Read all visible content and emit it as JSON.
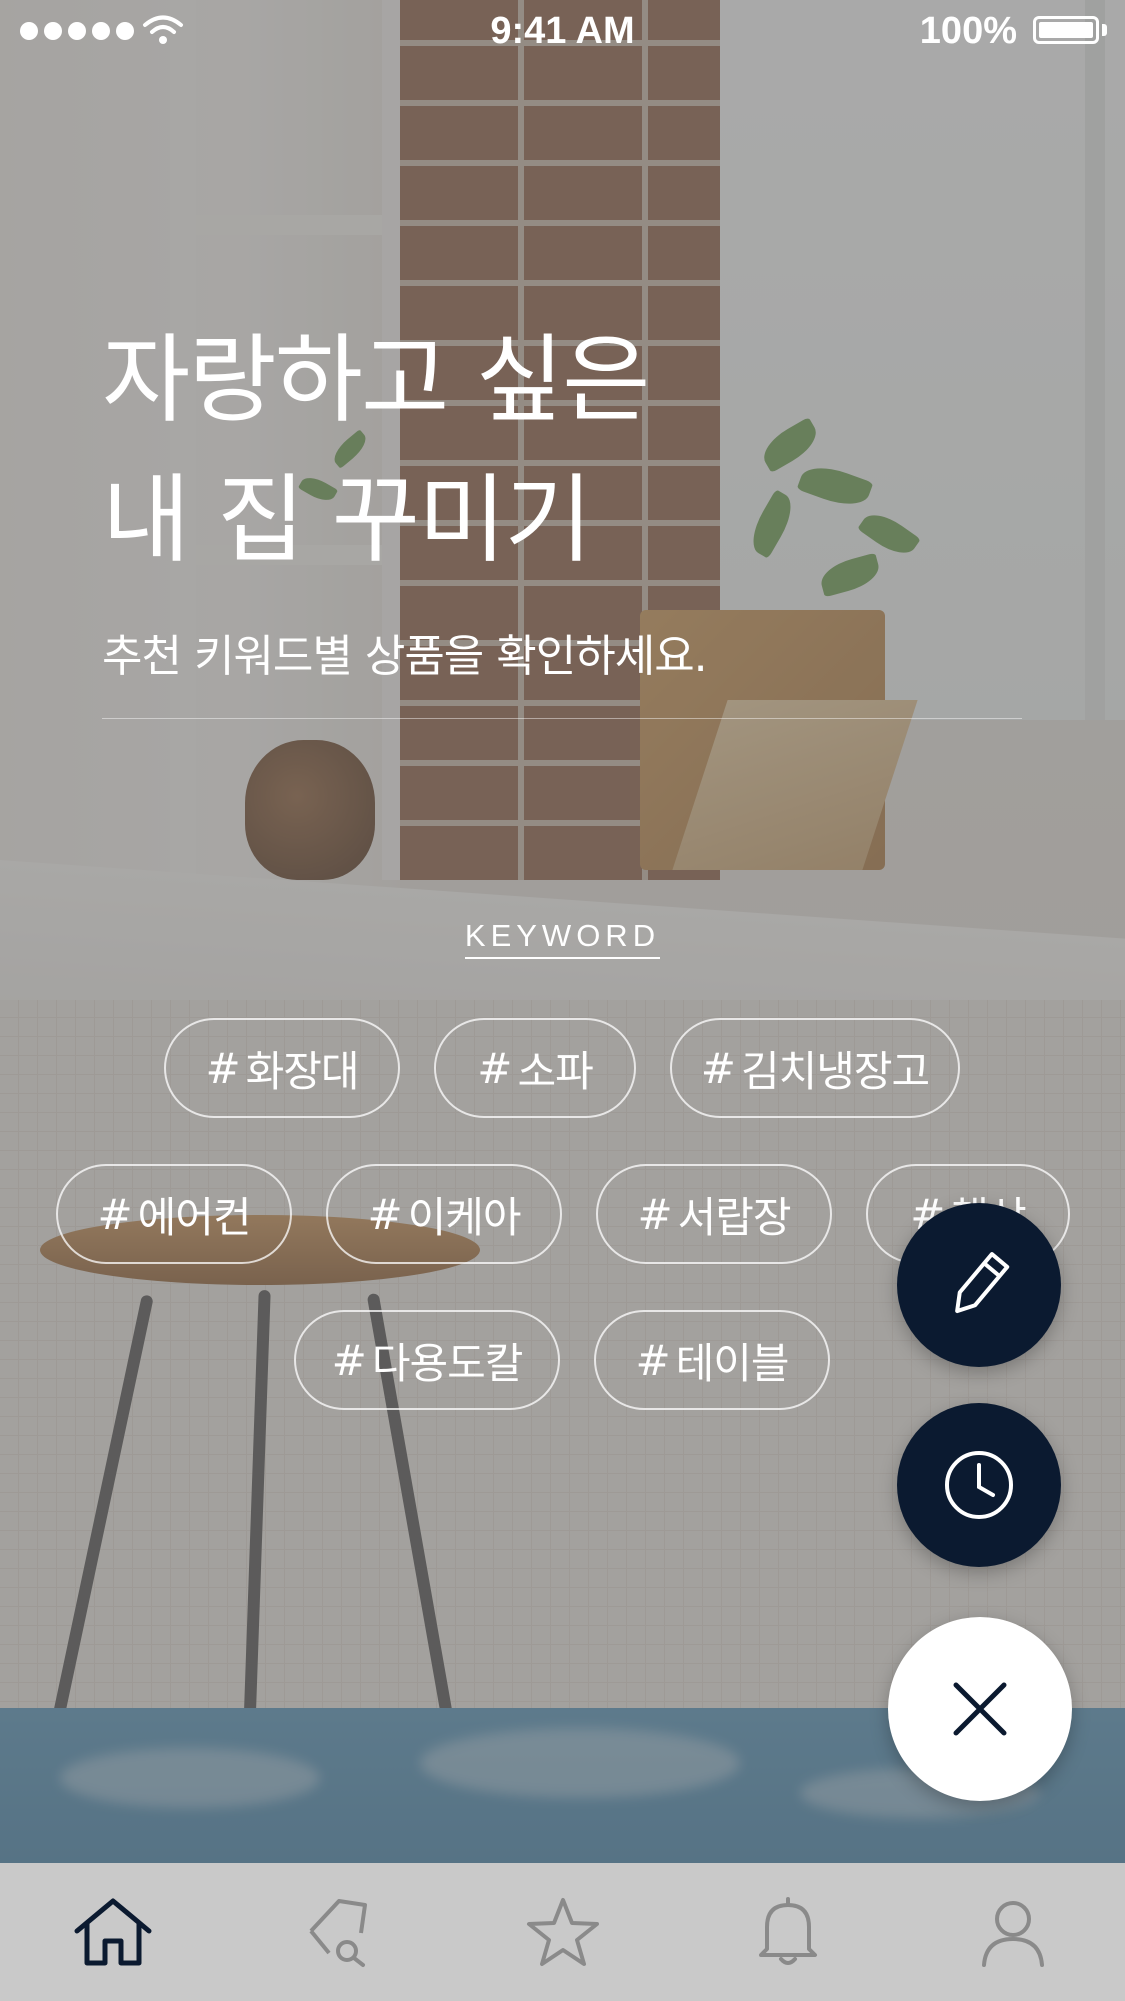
{
  "status_bar": {
    "time": "9:41 AM",
    "battery": "100%",
    "signal_icon": "signal-dots-icon",
    "wifi_icon": "wifi-icon",
    "battery_icon": "battery-icon"
  },
  "hero": {
    "title_line1": "자랑하고 싶은",
    "title_line2": "내 집 꾸미기",
    "subtitle": "추천 키워드별 상품을 확인하세요."
  },
  "keywords": {
    "label": "KEYWORD",
    "hash": "#",
    "items": [
      "화장대",
      "소파",
      "김치냉장고",
      "에어컨",
      "이케아",
      "서랍장",
      "책상",
      "다용도칼",
      "테이블"
    ]
  },
  "fab": {
    "edit_icon": "pencil-icon",
    "recent_icon": "clock-icon",
    "close_icon": "close-icon",
    "dark_color": "#0b1a30"
  },
  "tabbar": {
    "tabs": [
      {
        "icon": "home-icon",
        "active": true
      },
      {
        "icon": "search-tag-icon",
        "active": false
      },
      {
        "icon": "star-icon",
        "active": false
      },
      {
        "icon": "bell-icon",
        "active": false
      },
      {
        "icon": "user-icon",
        "active": false
      }
    ],
    "active_color": "#0b1a30",
    "inactive_color": "#8a8a8a"
  }
}
